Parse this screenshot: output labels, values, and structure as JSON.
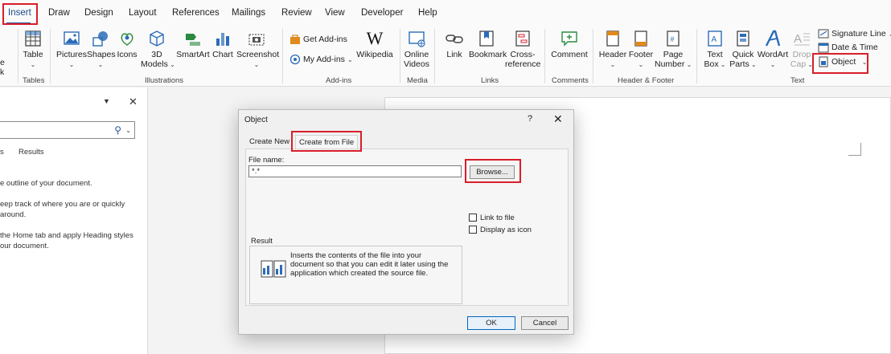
{
  "ribbon_tabs": [
    "Insert",
    "Draw",
    "Design",
    "Layout",
    "References",
    "Mailings",
    "Review",
    "View",
    "Developer",
    "Help"
  ],
  "active_tab": "Insert",
  "ribbon": {
    "partial_left": [
      "e",
      "k"
    ],
    "tables": {
      "table": "Table",
      "group": "Tables"
    },
    "illustrations": {
      "pictures": "Pictures",
      "shapes": "Shapes",
      "icons": "Icons",
      "models_line1": "3D",
      "models_line2": "Models",
      "smartart": "SmartArt",
      "chart": "Chart",
      "screenshot": "Screenshot",
      "group": "Illustrations"
    },
    "addins": {
      "get": "Get Add-ins",
      "my": "My Add-ins",
      "wikipedia": "Wikipedia",
      "group": "Add-ins"
    },
    "media": {
      "line1": "Online",
      "line2": "Videos",
      "group": "Media"
    },
    "links": {
      "link": "Link",
      "bookmark": "Bookmark",
      "cross1": "Cross-",
      "cross2": "reference",
      "group": "Links"
    },
    "comments": {
      "comment": "Comment",
      "group": "Comments"
    },
    "header_footer": {
      "header": "Header",
      "footer": "Footer",
      "page1": "Page",
      "page2": "Number",
      "group": "Header & Footer"
    },
    "text": {
      "textbox1": "Text",
      "textbox2": "Box",
      "quick1": "Quick",
      "quick2": "Parts",
      "wordart": "WordArt",
      "drop1": "Drop",
      "drop2": "Cap",
      "signature": "Signature Line",
      "datetime": "Date & Time",
      "object": "Object",
      "group": "Text"
    }
  },
  "nav_pane": {
    "results_tab": "Results",
    "partial_tab": "s",
    "lines": [
      "e outline of your document.",
      "eep track of where you are or quickly",
      "around.",
      "the Home tab and apply Heading styles",
      "our document."
    ]
  },
  "dialog": {
    "title": "Object",
    "help": "?",
    "close": "✕",
    "tab_create_new": "Create New",
    "tab_create_from_file": "Create from File",
    "file_name_label": "File name:",
    "file_name_value": "*.*",
    "browse": "Browse...",
    "link_to_file": "Link to file",
    "display_as_icon": "Display as icon",
    "result_label": "Result",
    "result_text": "Inserts the contents of the file into your document so that you can edit it later using the application which created the source file.",
    "ok": "OK",
    "cancel": "Cancel"
  },
  "colors": {
    "highlight": "#d81e2a",
    "accent": "#2b579a"
  }
}
